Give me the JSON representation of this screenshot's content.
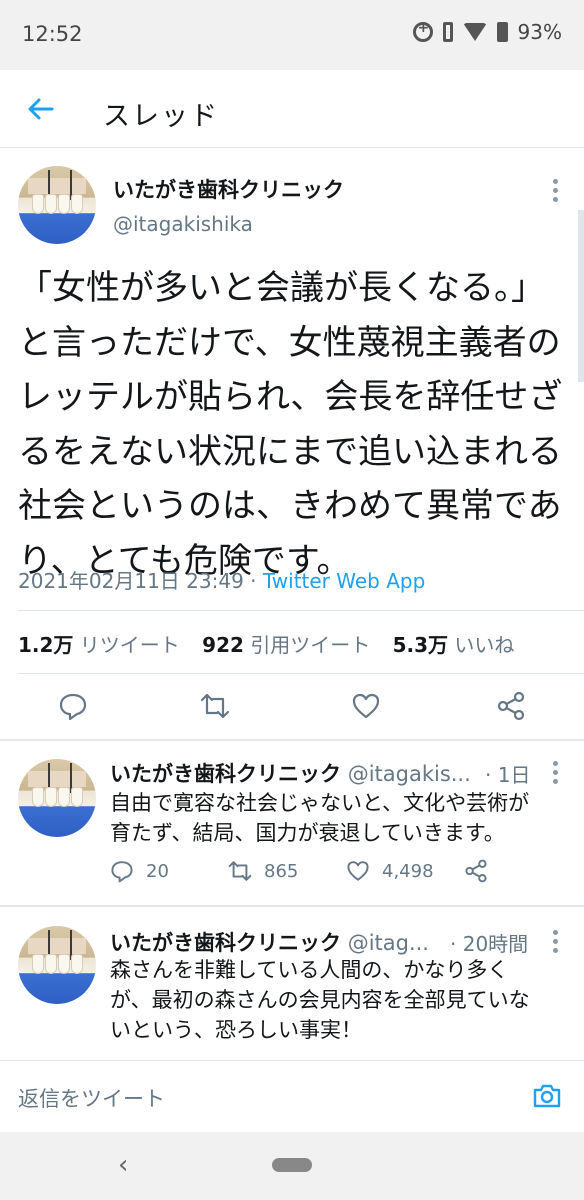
{
  "status_bar": {
    "time": "12:52",
    "battery": "93%",
    "icons": [
      "data-saver-icon",
      "vibrate-icon",
      "wifi-icon",
      "battery-icon"
    ]
  },
  "header": {
    "title": "スレッド",
    "back_icon": "arrow-left-icon"
  },
  "main_tweet": {
    "author_name": "いたがき歯科クリニック",
    "author_handle": "@itagakishika",
    "text_lines": [
      "「女性が多いと会議が長くなる。」",
      "と言っただけで、女性蔑視主義者の",
      "レッテルが貼られ、会長を辞任せざ",
      "るをえない状況にまで追い込まれる",
      "社会というのは、きわめて異常であ",
      "り、とても危険です。"
    ],
    "timestamp": "2021年02月11日 23:49",
    "separator": "·",
    "source": "Twitter Web App",
    "stats": {
      "retweets_count": "1.2万",
      "retweets_label": "リツイート",
      "quotes_count": "922",
      "quotes_label": "引用ツイート",
      "likes_count": "5.3万",
      "likes_label": "いいね"
    },
    "actions": [
      "reply-icon",
      "retweet-icon",
      "like-icon",
      "share-icon"
    ]
  },
  "replies": [
    {
      "author_name": "いたがき歯科クリニック",
      "author_handle": "@itagakis...",
      "time": "· 1日",
      "text_lines": [
        "自由で寛容な社会じゃないと、文化や芸術が",
        "育たず、結局、国力が衰退していきます。"
      ],
      "reply_count": "20",
      "retweet_count": "865",
      "like_count": "4,498"
    },
    {
      "author_name": "いたがき歯科クリニック",
      "author_handle": "@itag...",
      "time": "· 20時間",
      "text_lines": [
        "森さんを非難している人間の、かなり多く",
        "が、最初の森さんの会見内容を全部見ていな",
        "いという、恐ろしい事実！"
      ]
    }
  ],
  "reply_bar": {
    "placeholder": "返信をツイート",
    "camera_icon": "camera-icon"
  },
  "colors": {
    "accent": "#1da1f2",
    "text_primary": "#14171a",
    "text_secondary": "#657786",
    "divider": "#e1e8ed"
  }
}
